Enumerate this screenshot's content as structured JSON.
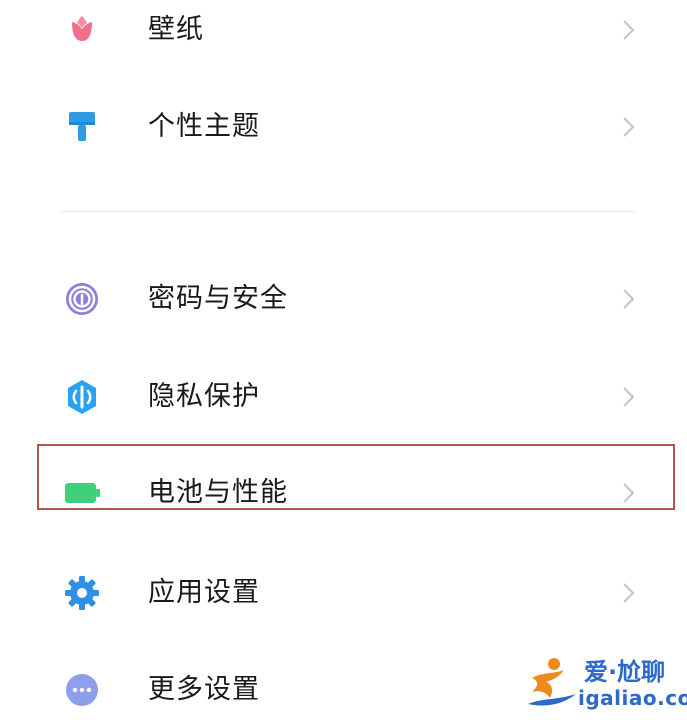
{
  "settings": {
    "items": [
      {
        "label": "壁纸",
        "icon": "wallpaper-icon"
      },
      {
        "label": "个性主题",
        "icon": "theme-brush-icon"
      },
      {
        "label": "密码与安全",
        "icon": "fingerprint-icon"
      },
      {
        "label": "隐私保护",
        "icon": "privacy-shield-icon"
      },
      {
        "label": "电池与性能",
        "icon": "battery-icon"
      },
      {
        "label": "应用设置",
        "icon": "gear-icon"
      },
      {
        "label": "更多设置",
        "icon": "more-dots-icon"
      }
    ]
  },
  "highlight": {
    "target": "电池与性能",
    "color": "#b4534c"
  },
  "watermark": {
    "title": "爱·尬聊",
    "url": "igaliao.com"
  },
  "colors": {
    "wallpaper": "#f06f8c",
    "theme": "#2f9be6",
    "password": "#8c7fe0",
    "privacy": "#2ba2f0",
    "battery": "#3fd17a",
    "app_settings": "#2f8fe6",
    "more": "#8f9ee8"
  }
}
